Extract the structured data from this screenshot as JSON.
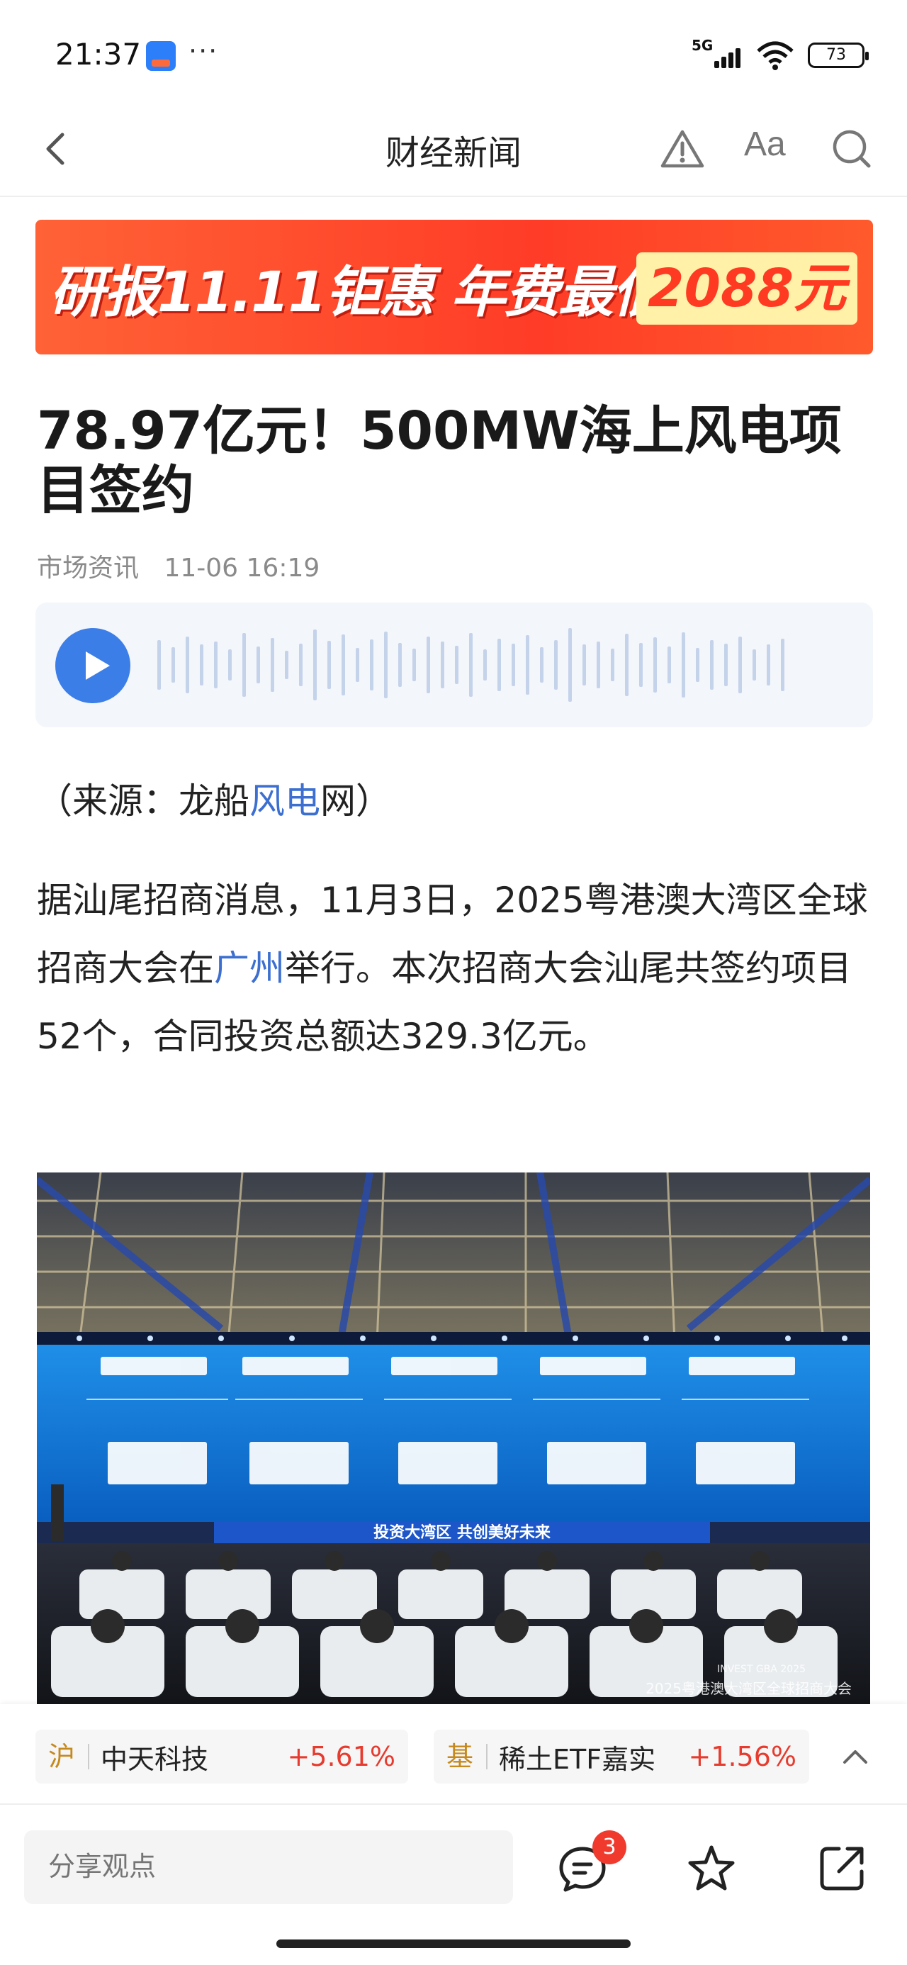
{
  "status_bar": {
    "time": "21:37",
    "dots": "···",
    "network": "5G",
    "battery": "73"
  },
  "nav": {
    "title": "财经新闻",
    "font_label": "Aa"
  },
  "banner": {
    "text": "研报11.11钜惠 年费最低价",
    "price": "2088元"
  },
  "article": {
    "title": "78.97亿元！500MW海上风电项目签约",
    "source_tag": "市场资讯",
    "datetime": "11-06 16:19",
    "source_line": {
      "prefix": "（来源：龙船",
      "link": "风电",
      "suffix": "网）"
    },
    "body": {
      "part1": "据汕尾招商消息，11月3日，2025粤港澳大湾区全球招商大会在",
      "link": "广州",
      "part2": "举行。本次招商大会汕尾共签约项目52个，合同投资总额达329.3亿元。"
    },
    "photo": {
      "stage_slogan": "投资大湾区 共创美好未来",
      "watermark": "2025粤港澳大湾区全球招商大会",
      "logo": "INVEST GBA 2025"
    }
  },
  "tickers": [
    {
      "market": "沪",
      "name": "中天科技",
      "change": "+5.61%"
    },
    {
      "market": "基",
      "name": "稀土ETF嘉实",
      "change": "+1.56%"
    }
  ],
  "bottom_bar": {
    "comment_placeholder": "分享观点",
    "comment_count": "3"
  },
  "colors": {
    "accent_blue": "#3c7ee8",
    "link_blue": "#3c6fd0",
    "up_red": "#e63b2e",
    "banner_orange": "#ff4a2a"
  }
}
